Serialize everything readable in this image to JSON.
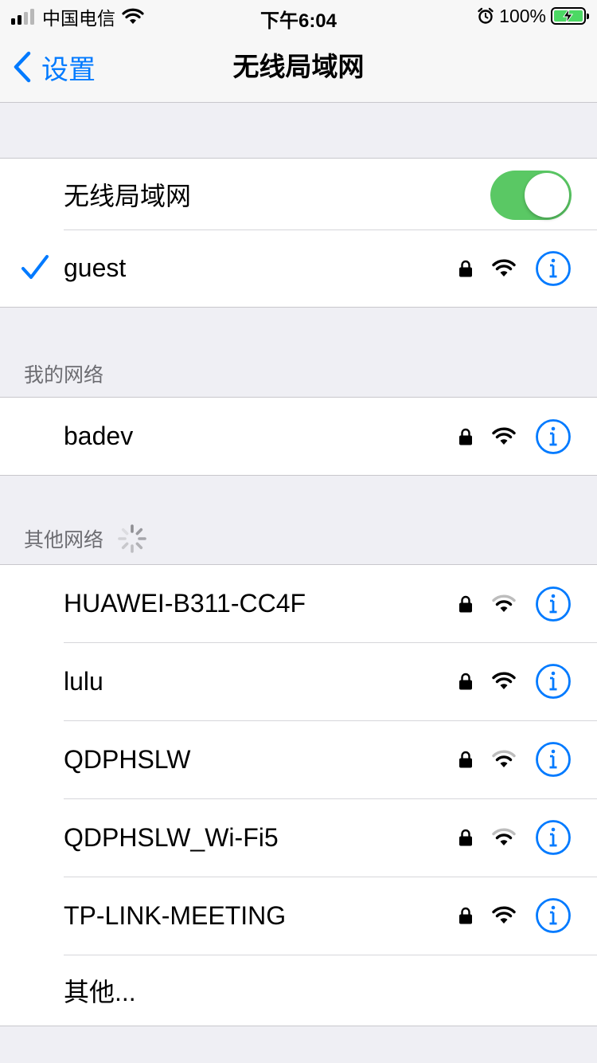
{
  "status_bar": {
    "carrier": "中国电信",
    "time": "下午6:04",
    "battery_percent": "100%",
    "signal_bars": 4,
    "signal_bars_active": 2
  },
  "nav": {
    "back_label": "设置",
    "title": "无线局域网"
  },
  "wifi_toggle": {
    "label": "无线局域网",
    "on": true,
    "color": "#5ac864"
  },
  "connected_network": {
    "name": "guest",
    "secured": true,
    "signal": "full"
  },
  "my_networks": {
    "header": "我的网络",
    "items": [
      {
        "name": "badev",
        "secured": true,
        "signal": "full"
      }
    ]
  },
  "other_networks": {
    "header": "其他网络",
    "scanning": true,
    "items": [
      {
        "name": "HUAWEI-B311-CC4F",
        "secured": true,
        "signal": "weak"
      },
      {
        "name": "lulu",
        "secured": true,
        "signal": "full"
      },
      {
        "name": "QDPHSLW",
        "secured": true,
        "signal": "weak"
      },
      {
        "name": "QDPHSLW_Wi-Fi5",
        "secured": true,
        "signal": "weak"
      },
      {
        "name": "TP-LINK-MEETING",
        "secured": true,
        "signal": "full"
      }
    ],
    "other_label": "其他..."
  },
  "colors": {
    "accent": "#007aff",
    "battery": "#4cd964"
  }
}
